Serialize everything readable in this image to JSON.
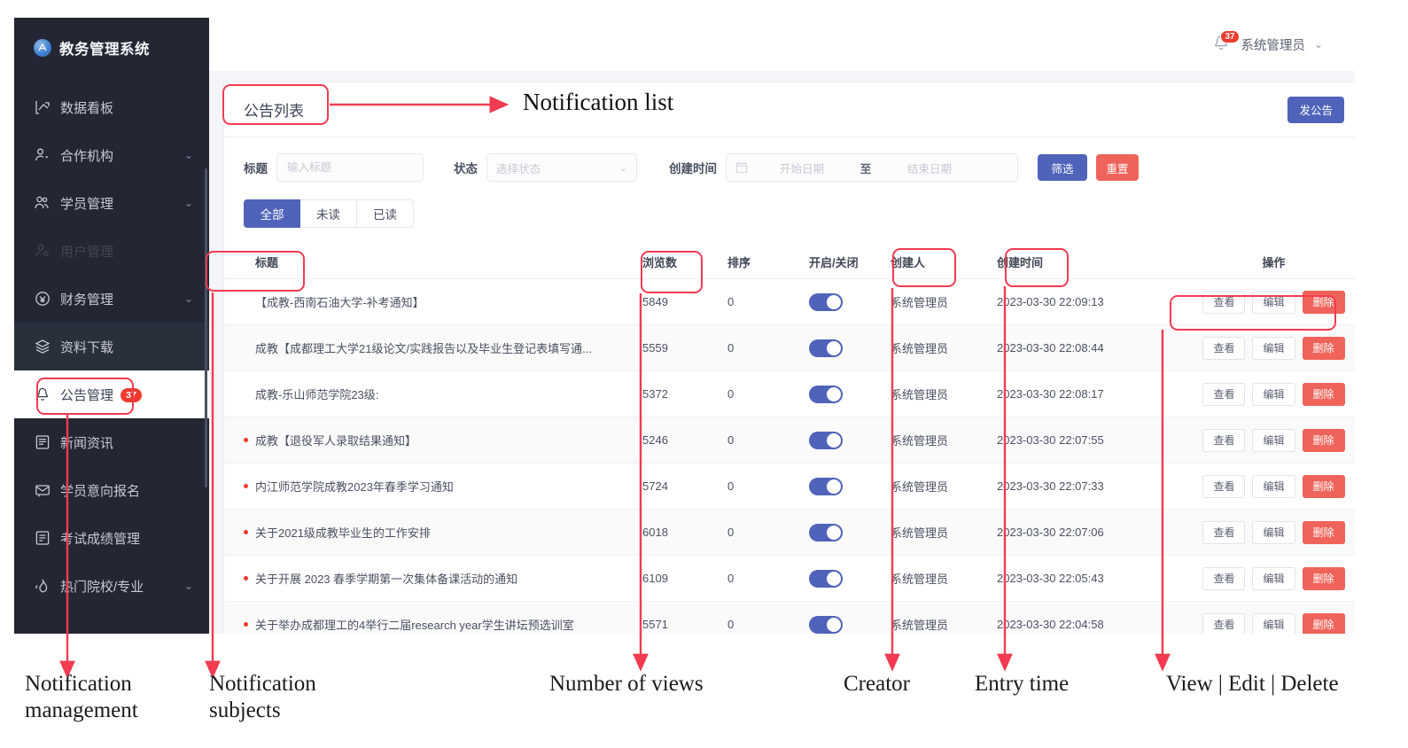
{
  "app": {
    "brand": {
      "title": "教务管理系统",
      "logo_icon": "app-logo-icon"
    },
    "sidebar": {
      "items": [
        {
          "label": "数据看板",
          "icon": "chart-trend-icon",
          "arrow": "",
          "badge": "",
          "state": "normal"
        },
        {
          "label": "合作机构",
          "icon": "org-user-icon",
          "arrow": "⌄",
          "badge": "",
          "state": "normal"
        },
        {
          "label": "学员管理",
          "icon": "users-icon",
          "arrow": "⌄",
          "badge": "",
          "state": "normal"
        },
        {
          "label": "用户管理",
          "icon": "user-gear-icon",
          "arrow": "",
          "badge": "",
          "state": "dim"
        },
        {
          "label": "财务管理",
          "icon": "money-circle-icon",
          "arrow": "⌄",
          "badge": "",
          "state": "normal"
        },
        {
          "label": "资料下载",
          "icon": "layers-icon",
          "arrow": "",
          "badge": "",
          "state": "highlight"
        },
        {
          "label": "公告管理",
          "icon": "bell-icon",
          "arrow": "",
          "badge": "37",
          "state": "active"
        },
        {
          "label": "新闻资讯",
          "icon": "news-icon",
          "arrow": "",
          "badge": "",
          "state": "normal"
        },
        {
          "label": "学员意向报名",
          "icon": "enroll-icon",
          "arrow": "",
          "badge": "",
          "state": "normal"
        },
        {
          "label": "考试成绩管理",
          "icon": "exam-score-icon",
          "arrow": "",
          "badge": "",
          "state": "normal"
        },
        {
          "label": "热门院校/专业",
          "icon": "hot-school-icon",
          "arrow": "⌄",
          "badge": "",
          "state": "normal"
        }
      ]
    },
    "topbar": {
      "bell_icon": "bell-icon",
      "bell_badge": "37",
      "user_name": "系统管理员",
      "caret_icon": "chevron-down-icon"
    },
    "page": {
      "title": "公告列表",
      "primary_button": "发公告"
    },
    "filters": {
      "title_label": "标题",
      "title_placeholder": "输入标题",
      "status_label": "状态",
      "status_placeholder": "选择状态",
      "time_label": "创建时间",
      "date_start_placeholder": "开始日期",
      "date_sep": "至",
      "date_end_placeholder": "结束日期",
      "calendar_icon": "calendar-icon",
      "filter_button": "筛选",
      "reset_button": "重置"
    },
    "tabs": [
      {
        "label": "全部",
        "active": true
      },
      {
        "label": "未读",
        "active": false
      },
      {
        "label": "已读",
        "active": false
      }
    ],
    "table": {
      "headers": {
        "title": "标题",
        "views": "浏览数",
        "sort": "排序",
        "switch": "开启/关闭",
        "owner": "创建人",
        "time": "创建时间",
        "actions": "操作"
      },
      "actions": {
        "view": "查看",
        "edit": "编辑",
        "delete": "删除"
      },
      "rows": [
        {
          "unread": false,
          "title": "【成教-西南石油大学-补考通知】",
          "views": "5849",
          "sort": "0",
          "enabled": true,
          "owner": "系统管理员",
          "time": "2023-03-30 22:09:13"
        },
        {
          "unread": false,
          "title": "成教【成都理工大学21级论文/实践报告以及毕业生登记表填写通...",
          "views": "5559",
          "sort": "0",
          "enabled": true,
          "owner": "系统管理员",
          "time": "2023-03-30 22:08:44"
        },
        {
          "unread": false,
          "title": "成教-乐山师范学院23级:",
          "views": "5372",
          "sort": "0",
          "enabled": true,
          "owner": "系统管理员",
          "time": "2023-03-30 22:08:17"
        },
        {
          "unread": true,
          "title": "成教【退役军人录取结果通知】",
          "views": "5246",
          "sort": "0",
          "enabled": true,
          "owner": "系统管理员",
          "time": "2023-03-30 22:07:55"
        },
        {
          "unread": true,
          "title": "内江师范学院成教2023年春季学习通知",
          "views": "5724",
          "sort": "0",
          "enabled": true,
          "owner": "系统管理员",
          "time": "2023-03-30 22:07:33"
        },
        {
          "unread": true,
          "title": "关于2021级成教毕业生的工作安排",
          "views": "6018",
          "sort": "0",
          "enabled": true,
          "owner": "系统管理员",
          "time": "2023-03-30 22:07:06"
        },
        {
          "unread": true,
          "title": "关于开展 2023 春季学期第一次集体备课活动的通知",
          "views": "6109",
          "sort": "0",
          "enabled": true,
          "owner": "系统管理员",
          "time": "2023-03-30 22:05:43"
        },
        {
          "unread": true,
          "title": "关于举办成都理工的4举行二届research year学生讲坛预选训室",
          "views": "5571",
          "sort": "0",
          "enabled": true,
          "owner": "系统管理员",
          "time": "2023-03-30 22:04:58"
        }
      ]
    }
  },
  "annotations": {
    "title_callout": "Notification list",
    "labels": [
      "Notification management",
      "Notification subjects",
      "Number of views",
      "Creator",
      "Entry time",
      "View | Edit | Delete"
    ],
    "accent_color": "#f23b50"
  }
}
